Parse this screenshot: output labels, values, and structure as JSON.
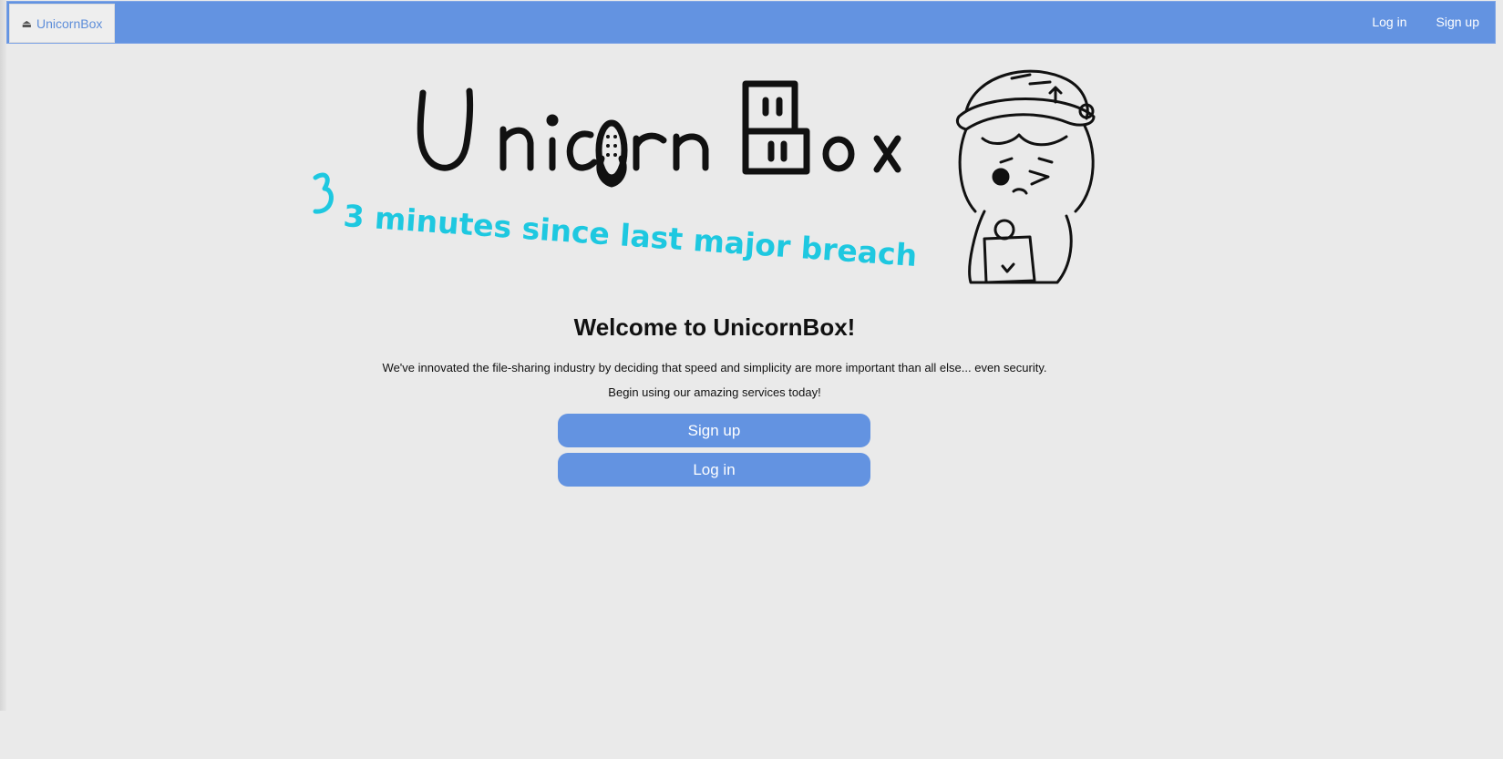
{
  "navbar": {
    "brand_label": "UnicornBox",
    "brand_icon": "box-icon",
    "login_label": "Log in",
    "signup_label": "Sign up"
  },
  "hero": {
    "logo_text_left": "Unic",
    "logo_text_mid": "rn",
    "logo_text_right": "ox",
    "subtitle": "3 minutes since last major breach"
  },
  "main": {
    "heading": "Welcome to UnicornBox!",
    "tagline": "We've innovated the file-sharing industry by deciding that speed and simplicity are more important than all else... even security.",
    "cta_text": "Begin using our amazing services today!",
    "signup_button": "Sign up",
    "login_button": "Log in"
  },
  "colors": {
    "accent": "#6393e1",
    "background": "#eaeaea",
    "subtitle": "#1ec8e0"
  }
}
